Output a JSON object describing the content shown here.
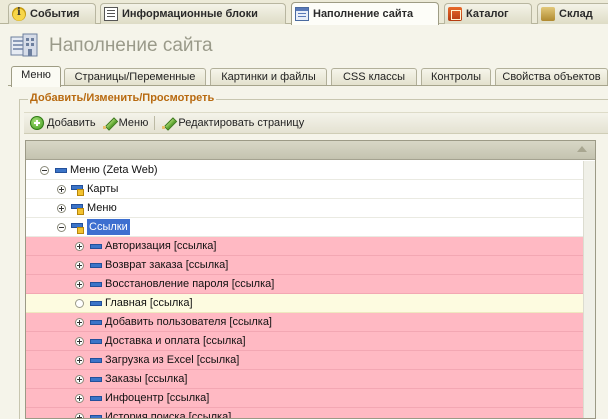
{
  "top_tabs": [
    {
      "label": "События",
      "icon": "info-icon"
    },
    {
      "label": "Информационные блоки",
      "icon": "info-blocks-icon"
    },
    {
      "label": "Наполнение сайта",
      "icon": "site-content-icon",
      "active": true
    },
    {
      "label": "Каталог",
      "icon": "catalog-icon"
    },
    {
      "label": "Склад",
      "icon": "warehouse-icon"
    }
  ],
  "page": {
    "title": "Наполнение сайта",
    "icon": "site-content-icon"
  },
  "sub_tabs": [
    {
      "label": "Меню",
      "active": true
    },
    {
      "label": "Страницы/Переменные"
    },
    {
      "label": "Картинки и файлы"
    },
    {
      "label": "CSS классы"
    },
    {
      "label": "Контролы"
    },
    {
      "label": "Свойства объектов"
    }
  ],
  "group": {
    "caption": "Добавить/Изменить/Просмотреть"
  },
  "toolbar": {
    "add_label": "Добавить",
    "menu_label": "Меню",
    "edit_page_label": "Редактировать страницу"
  },
  "tree": {
    "rows": [
      {
        "label": "Меню (Zeta Web)",
        "level": 0,
        "expander": "minus",
        "icon": "dash",
        "style": "normal"
      },
      {
        "label": "Карты",
        "level": 1,
        "expander": "plus",
        "icon": "folder",
        "style": "normal"
      },
      {
        "label": "Меню",
        "level": 1,
        "expander": "plus",
        "icon": "folder",
        "style": "normal"
      },
      {
        "label": "Ссылки",
        "level": 1,
        "expander": "minus",
        "icon": "folder",
        "style": "normal",
        "selected": true
      },
      {
        "label": "Авторизация [ссылка]",
        "level": 2,
        "expander": "plus",
        "icon": "dash",
        "style": "link"
      },
      {
        "label": "Возврат заказа [ссылка]",
        "level": 2,
        "expander": "plus",
        "icon": "dash",
        "style": "link"
      },
      {
        "label": "Восстановление пароля [ссылка]",
        "level": 2,
        "expander": "plus",
        "icon": "dash",
        "style": "link"
      },
      {
        "label": "Главная [ссылка]",
        "level": 2,
        "expander": "empty",
        "icon": "dash",
        "style": "main"
      },
      {
        "label": "Добавить пользователя [ссылка]",
        "level": 2,
        "expander": "plus",
        "icon": "dash",
        "style": "link"
      },
      {
        "label": "Доставка и оплата [ссылка]",
        "level": 2,
        "expander": "plus",
        "icon": "dash",
        "style": "link"
      },
      {
        "label": "Загрузка из Excel [ссылка]",
        "level": 2,
        "expander": "plus",
        "icon": "dash",
        "style": "link"
      },
      {
        "label": "Заказы [ссылка]",
        "level": 2,
        "expander": "plus",
        "icon": "dash",
        "style": "link"
      },
      {
        "label": "Инфоцентр [ссылка]",
        "level": 2,
        "expander": "plus",
        "icon": "dash",
        "style": "link"
      },
      {
        "label": "История поиска [ссылка]",
        "level": 2,
        "expander": "plus",
        "icon": "dash",
        "style": "link"
      }
    ]
  },
  "colors": {
    "link_row": "#ffb9c3",
    "main_row": "#fdfbe0",
    "selection": "#3d6fd0",
    "group_caption": "#b86a10"
  }
}
